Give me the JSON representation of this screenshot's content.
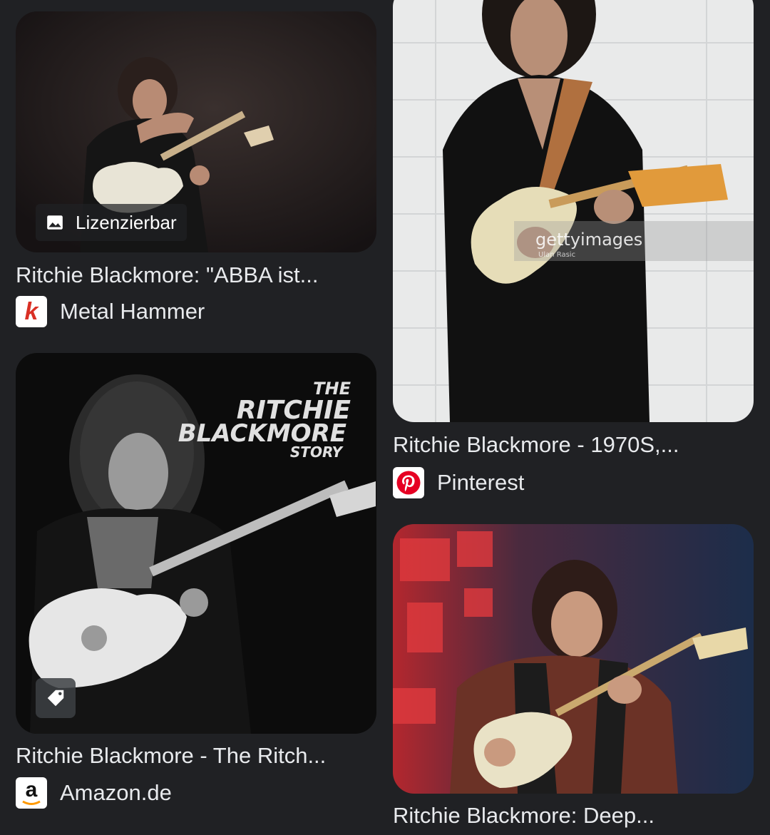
{
  "results": {
    "left": [
      {
        "title": "Ritchie Blackmore: \"ABBA ist...",
        "source": "Metal Hammer",
        "badge": "Lizenzierbar",
        "favicon_letter": "k"
      },
      {
        "title": "Ritchie Blackmore - The Ritch...",
        "source": "Amazon.de",
        "favicon_letter": "a",
        "poster": {
          "line1": "THE",
          "line2": "RITCHIE",
          "line3": "BLACKMORE",
          "line4": "STORY"
        }
      }
    ],
    "right": [
      {
        "title": "Ritchie Blackmore - 1970S,...",
        "source": "Pinterest",
        "watermark": "gettyimages",
        "watermark_sub": "Ulan Rasic"
      },
      {
        "title": "Ritchie Blackmore: Deep..."
      }
    ]
  },
  "colors": {
    "background": "#202124",
    "text": "#e8eaed",
    "metal_hammer": "#d93025",
    "pinterest": "#e60023",
    "amazon_smile": "#ff9900"
  },
  "icons": {
    "license": "image-icon",
    "shopping": "tag-icon"
  }
}
